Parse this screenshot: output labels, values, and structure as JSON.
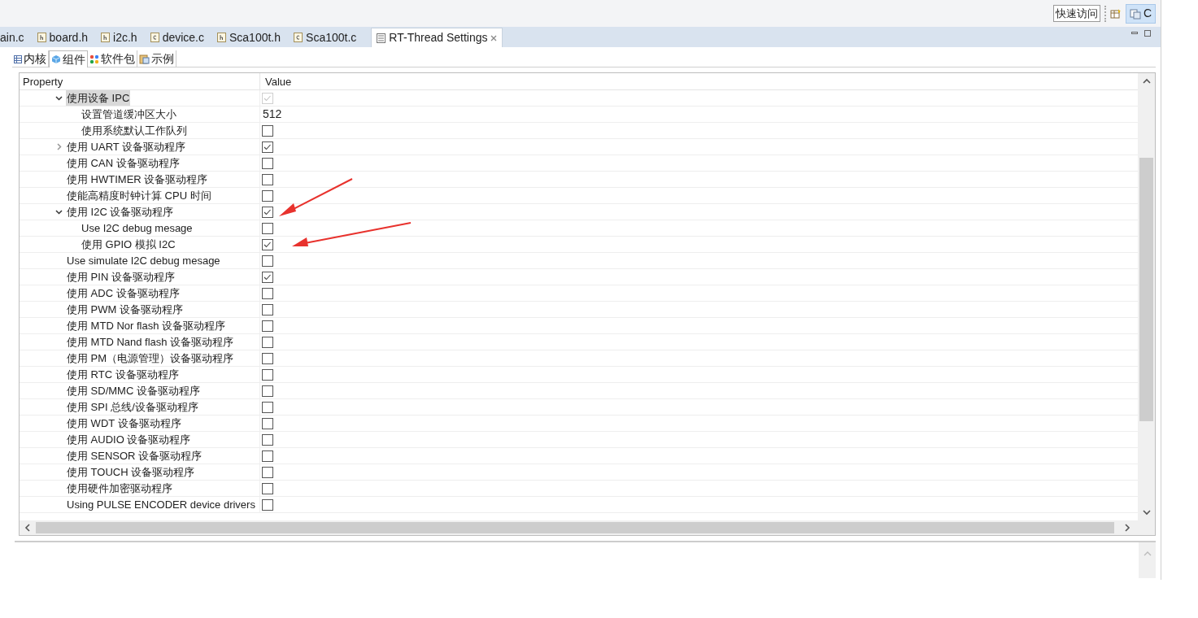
{
  "toolbar": {
    "quick_access": "快速访问",
    "perspective": "C"
  },
  "editor_tabs": [
    {
      "label": "ain.c",
      "selected": false
    },
    {
      "label": "board.h",
      "kind": "h",
      "selected": false
    },
    {
      "label": "i2c.h",
      "kind": "h",
      "selected": false
    },
    {
      "label": "device.c",
      "kind": "c",
      "selected": false
    },
    {
      "label": "Sca100t.h",
      "kind": "h",
      "selected": false
    },
    {
      "label": "Sca100t.c",
      "kind": "c",
      "selected": false
    },
    {
      "label": "RT-Thread Settings",
      "kind": "settings",
      "selected": true
    }
  ],
  "settings_tabs": [
    {
      "label": "内核",
      "kind": "table",
      "selected": false
    },
    {
      "label": "组件",
      "kind": "cube",
      "selected": true
    },
    {
      "label": "软件包",
      "kind": "dots",
      "selected": false
    },
    {
      "label": "示例",
      "kind": "clipboard",
      "selected": false
    }
  ],
  "table": {
    "columns": [
      "Property",
      "Value"
    ],
    "rows": [
      {
        "label": "使用设备 IPC",
        "kind": "checkbox",
        "checked": true,
        "disabled": true,
        "selected": true,
        "expanded": true,
        "children": [
          {
            "label": "设置管道缓冲区大小",
            "kind": "text",
            "value": "512",
            "selected": false
          },
          {
            "label": "使用系统默认工作队列",
            "kind": "checkbox",
            "checked": false,
            "disabled": false,
            "selected": false
          }
        ]
      },
      {
        "label": "使用 UART 设备驱动程序",
        "kind": "checkbox",
        "checked": true,
        "disabled": false,
        "selected": false,
        "expanded": false
      },
      {
        "label": "使用 CAN 设备驱动程序",
        "kind": "checkbox",
        "checked": false,
        "disabled": false,
        "selected": false
      },
      {
        "label": "使用 HWTIMER 设备驱动程序",
        "kind": "checkbox",
        "checked": false,
        "disabled": false,
        "selected": false
      },
      {
        "label": "使能高精度时钟计算 CPU 时间",
        "kind": "checkbox",
        "checked": false,
        "disabled": false,
        "selected": false
      },
      {
        "label": "使用 I2C 设备驱动程序",
        "kind": "checkbox",
        "checked": true,
        "disabled": false,
        "selected": false,
        "expanded": true,
        "children": [
          {
            "label": "Use I2C debug mesage",
            "kind": "checkbox",
            "checked": false,
            "disabled": false,
            "selected": false
          },
          {
            "label": "使用 GPIO 模拟 I2C",
            "kind": "checkbox",
            "checked": true,
            "disabled": false,
            "selected": false
          }
        ]
      },
      {
        "label": "Use simulate I2C debug mesage",
        "kind": "checkbox",
        "checked": false,
        "disabled": false,
        "selected": false
      },
      {
        "label": "使用 PIN 设备驱动程序",
        "kind": "checkbox",
        "checked": true,
        "disabled": false,
        "selected": false
      },
      {
        "label": "使用 ADC 设备驱动程序",
        "kind": "checkbox",
        "checked": false,
        "disabled": false,
        "selected": false
      },
      {
        "label": "使用 PWM 设备驱动程序",
        "kind": "checkbox",
        "checked": false,
        "disabled": false,
        "selected": false
      },
      {
        "label": "使用 MTD Nor flash 设备驱动程序",
        "kind": "checkbox",
        "checked": false,
        "disabled": false,
        "selected": false
      },
      {
        "label": "使用 MTD Nand flash 设备驱动程序",
        "kind": "checkbox",
        "checked": false,
        "disabled": false,
        "selected": false
      },
      {
        "label": "使用 PM（电源管理）设备驱动程序",
        "kind": "checkbox",
        "checked": false,
        "disabled": false,
        "selected": false
      },
      {
        "label": "使用 RTC 设备驱动程序",
        "kind": "checkbox",
        "checked": false,
        "disabled": false,
        "selected": false
      },
      {
        "label": "使用 SD/MMC 设备驱动程序",
        "kind": "checkbox",
        "checked": false,
        "disabled": false,
        "selected": false
      },
      {
        "label": "使用 SPI 总线/设备驱动程序",
        "kind": "checkbox",
        "checked": false,
        "disabled": false,
        "selected": false
      },
      {
        "label": "使用 WDT 设备驱动程序",
        "kind": "checkbox",
        "checked": false,
        "disabled": false,
        "selected": false
      },
      {
        "label": "使用 AUDIO 设备驱动程序",
        "kind": "checkbox",
        "checked": false,
        "disabled": false,
        "selected": false
      },
      {
        "label": "使用 SENSOR 设备驱动程序",
        "kind": "checkbox",
        "checked": false,
        "disabled": false,
        "selected": false
      },
      {
        "label": "使用 TOUCH 设备驱动程序",
        "kind": "checkbox",
        "checked": false,
        "disabled": false,
        "selected": false
      },
      {
        "label": "使用硬件加密驱动程序",
        "kind": "checkbox",
        "checked": false,
        "disabled": false,
        "selected": false
      },
      {
        "label": "Using PULSE ENCODER device drivers",
        "kind": "checkbox",
        "checked": false,
        "disabled": false,
        "selected": false
      }
    ]
  }
}
